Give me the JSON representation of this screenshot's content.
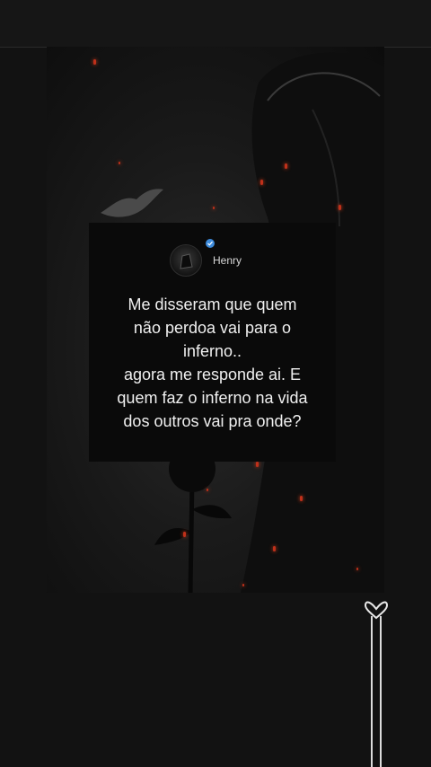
{
  "post": {
    "author_name": "Henry",
    "verified": true,
    "quote_lines": [
      "Me disseram que quem",
      "não perdoa vai para o",
      "inferno..",
      "agora me responde ai. E",
      "quem faz o inferno na vida",
      "dos outros vai pra onde?"
    ]
  },
  "colors": {
    "background": "#121212",
    "card": "#0a0a0a",
    "ember": "#c0301a",
    "verified": "#3d8bdc",
    "text": "#f0f0f0"
  },
  "icons": {
    "avatar": "avatar-icon",
    "verified": "verified-check-icon",
    "swipe": "swipe-heart-icon"
  }
}
